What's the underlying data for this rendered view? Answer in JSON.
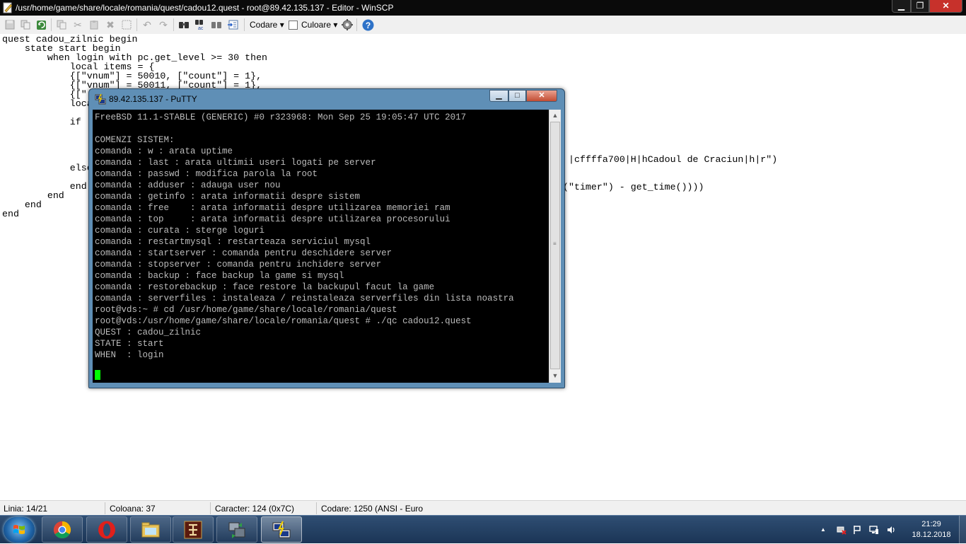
{
  "winscp": {
    "title": "/usr/home/game/share/locale/romania/quest/cadou12.quest - root@89.42.135.137 - Editor - WinSCP",
    "window_buttons": {
      "minimize": "▁",
      "maximize": "❐",
      "close": "✕"
    },
    "toolbar": {
      "encoding_menu": "Codare ▾",
      "color_menu": "Culoare ▾",
      "icons": [
        "save-icon",
        "copy-icon",
        "refresh-icon",
        "copy-icon",
        "cut-icon",
        "paste-icon",
        "delete-icon",
        "select-all-icon",
        "undo-icon",
        "redo-icon",
        "find-icon",
        "replace-icon",
        "find-next-icon",
        "goto-line-icon",
        "settings-icon",
        "help-icon"
      ]
    },
    "editor": {
      "code": "quest cadou_zilnic begin\n    state start begin\n        when login with pc.get_level >= 30 then\n            local items = {\n            {[\"vnum\"] = 50010, [\"count\"] = 1},\n            {[\"vnum\"] = 50011, [\"count\"] = 1},\n            {[\"\n            loca\n\n            if\n\n\n\n\n            else\n\n            end\n        end\n    end\nend",
      "fragment_line_a": "|cffffa700|H|hCadoul de Craciun|h|r\")",
      "fragment_line_b": "(\"timer\") - get_time())))"
    },
    "status": {
      "line": "Linia: 14/21",
      "column": "Coloana: 37",
      "character": "Caracter: 124 (0x7C)",
      "encoding": "Codare: 1250  (ANSI - Euro"
    }
  },
  "putty": {
    "title": "89.42.135.137 - PuTTY",
    "window_buttons": {
      "minimize": "▁",
      "maximize": "□",
      "close": "✕"
    },
    "terminal": "FreeBSD 11.1-STABLE (GENERIC) #0 r323968: Mon Sep 25 19:05:47 UTC 2017\n\nCOMENZI SISTEM:\ncomanda : w : arata uptime\ncomanda : last : arata ultimii useri logati pe server\ncomanda : passwd : modifica parola la root\ncomanda : adduser : adauga user nou\ncomanda : getinfo : arata informatii despre sistem\ncomanda : free    : arata informatii despre utilizarea memoriei ram\ncomanda : top     : arata informatii despre utilizarea procesorului\ncomanda : curata : sterge loguri\ncomanda : restartmysql : restarteaza serviciul mysql\ncomanda : startserver : comanda pentru deschidere server\ncomanda : stopserver : comanda pentru inchidere server\ncomanda : backup : face backup la game si mysql\ncomanda : restorebackup : face restore la backupul facut la game\ncomanda : serverfiles : instaleaza / reinstaleaza serverfiles din lista noastra\nroot@vds:~ # cd /usr/home/game/share/locale/romania/quest\nroot@vds:/usr/home/game/share/locale/romania/quest # ./qc cadou12.quest\nQUEST : cadou_zilnic\nSTATE : start\nWHEN  : login",
    "scroll_up": "▲",
    "scroll_down": "▼",
    "scroll_grip": "≡"
  },
  "taskbar": {
    "apps": [
      "chrome-icon",
      "opera-icon",
      "explorer-icon",
      "game-icon",
      "winscp-icon",
      "putty-icon"
    ],
    "tray_up": "▲",
    "clock_time": "21:29",
    "clock_date": "18.12.2018"
  },
  "colors": {
    "winscp_title_bg": "#0a0a0a",
    "close_red": "#c7312b",
    "putty_frame": "#5f8fb6",
    "terminal_bg": "#000000",
    "terminal_fg": "#bbbbbb",
    "cursor": "#00ff00",
    "taskbar": "#1f3a5e"
  }
}
